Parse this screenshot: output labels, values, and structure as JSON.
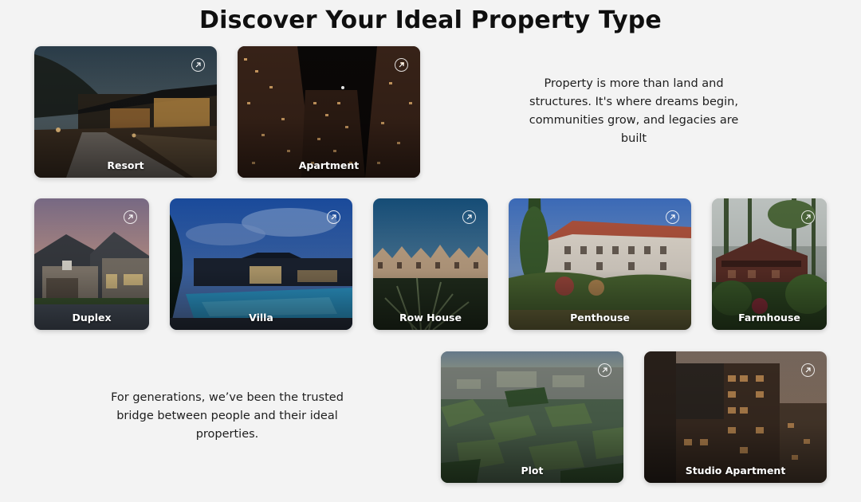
{
  "header": {
    "title": "Discover Your Ideal Property Type"
  },
  "intro_text": "Property is more than land and structures. It's where dreams begin, communities grow, and legacies are built",
  "legacy_text": "For generations, we’ve been the trusted bridge between people and their ideal properties.",
  "cards": {
    "resort": {
      "label": "Resort",
      "icon": "arrow-up-right-icon"
    },
    "apartment": {
      "label": "Apartment",
      "icon": "arrow-up-right-icon"
    },
    "duplex": {
      "label": "Duplex",
      "icon": "arrow-up-right-icon"
    },
    "villa": {
      "label": "Villa",
      "icon": "arrow-up-right-icon"
    },
    "row_house": {
      "label": "Row House",
      "icon": "arrow-up-right-icon"
    },
    "penthouse": {
      "label": "Penthouse",
      "icon": "arrow-up-right-icon"
    },
    "farmhouse": {
      "label": "Farmhouse",
      "icon": "arrow-up-right-icon"
    },
    "plot": {
      "label": "Plot",
      "icon": "arrow-up-right-icon"
    },
    "studio_apartment": {
      "label": "Studio Apartment",
      "icon": "arrow-up-right-icon"
    }
  },
  "colors": {
    "background": "#f3f3f3",
    "text": "#111111",
    "card_label": "#ffffff"
  }
}
